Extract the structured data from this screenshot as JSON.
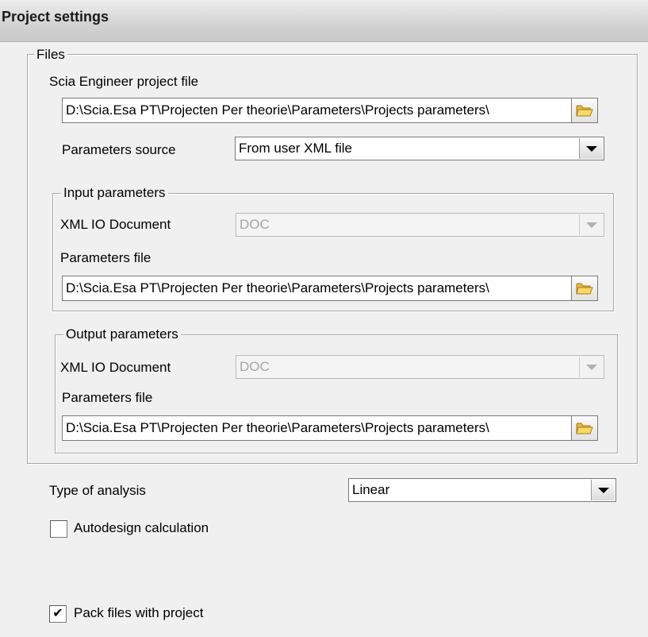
{
  "title": "Project settings",
  "files": {
    "legend": "Files",
    "project_file_label": "Scia Engineer project file",
    "project_file_value": "D:\\Scia.Esa PT\\Projecten Per theorie\\Parameters\\Projects parameters\\",
    "params_source_label": "Parameters source",
    "params_source_value": "From user XML file",
    "input": {
      "legend": "Input parameters",
      "xml_doc_label": "XML IO Document",
      "xml_doc_value": "DOC",
      "params_file_label": "Parameters file",
      "params_file_value": "D:\\Scia.Esa PT\\Projecten Per theorie\\Parameters\\Projects parameters\\"
    },
    "output": {
      "legend": "Output parameters",
      "xml_doc_label": "XML IO Document",
      "xml_doc_value": "DOC",
      "params_file_label": "Parameters file",
      "params_file_value": "D:\\Scia.Esa PT\\Projecten Per theorie\\Parameters\\Projects parameters\\"
    }
  },
  "analysis": {
    "label": "Type of analysis",
    "value": "Linear"
  },
  "autodesign": {
    "label": "Autodesign calculation",
    "checked": false
  },
  "pack": {
    "label": "Pack files with project",
    "checked": true,
    "mark": "✔"
  },
  "icons": {
    "browse": "folder-open-icon",
    "dropdown": "dropdown-arrow-icon"
  },
  "colors": {
    "folder_fill": "#f5c94a",
    "folder_edge": "#b58a1b"
  }
}
